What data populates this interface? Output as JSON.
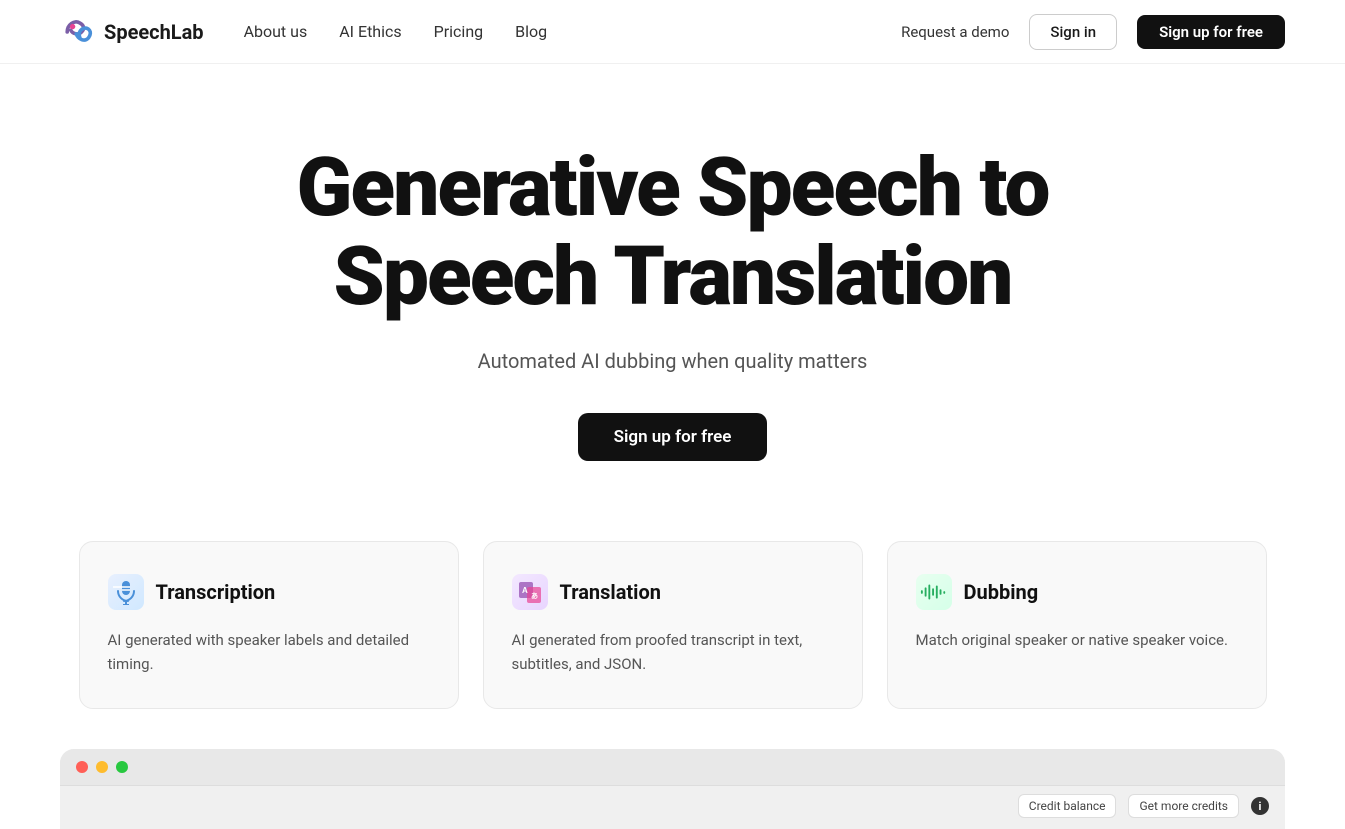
{
  "navbar": {
    "logo_text": "SpeechLab",
    "nav_items": [
      {
        "label": "About us",
        "id": "about-us"
      },
      {
        "label": "AI Ethics",
        "id": "ai-ethics"
      },
      {
        "label": "Pricing",
        "id": "pricing"
      },
      {
        "label": "Blog",
        "id": "blog"
      }
    ],
    "demo_label": "Request a demo",
    "signin_label": "Sign in",
    "signup_label": "Sign up for free"
  },
  "hero": {
    "title": "Generative Speech to Speech Translation",
    "subtitle": "Automated AI dubbing when quality matters",
    "cta_label": "Sign up for free"
  },
  "cards": [
    {
      "id": "transcription",
      "icon": "🎙️",
      "title": "Transcription",
      "description": "AI generated with speaker labels and detailed timing."
    },
    {
      "id": "translation",
      "icon": "🅰",
      "title": "Translation",
      "description": "AI generated from proofed transcript in text, subtitles, and JSON."
    },
    {
      "id": "dubbing",
      "icon": "🎵",
      "title": "Dubbing",
      "description": "Match original speaker or native speaker voice."
    }
  ],
  "preview": {
    "credit_label": "Credit balance",
    "more_credits_label": "Get more credits",
    "info_label": "i"
  }
}
